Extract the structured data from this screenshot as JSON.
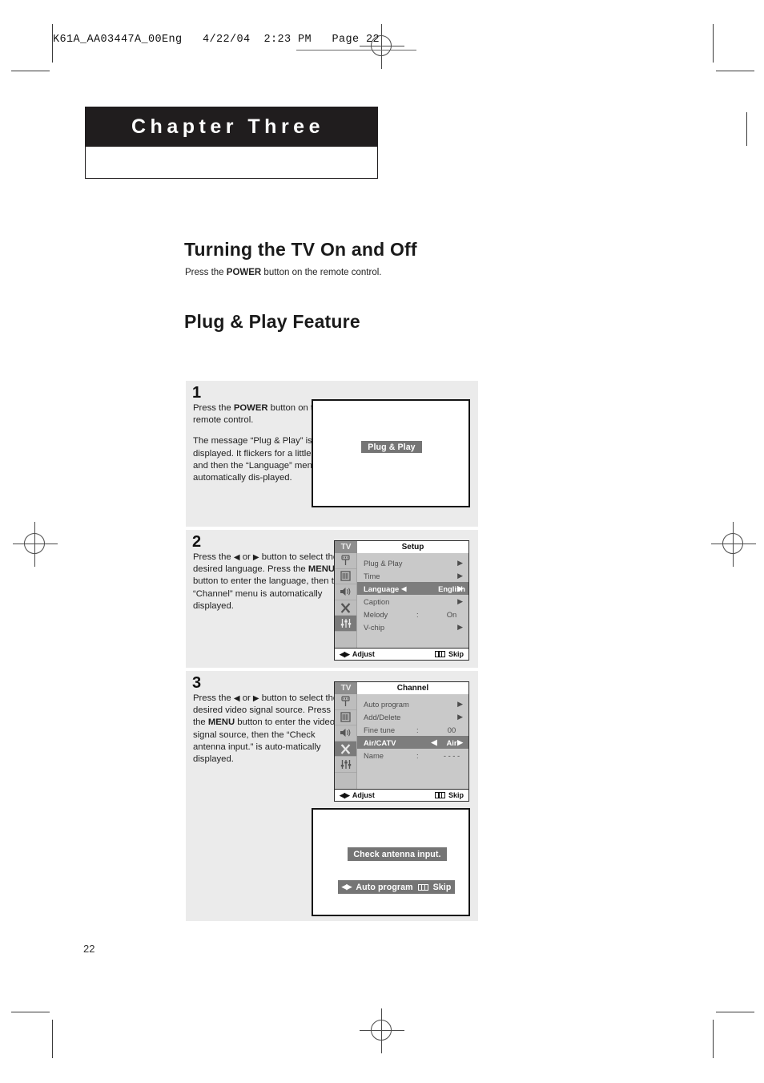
{
  "print_marks": {
    "file_header": "K61A_AA03447A_00Eng   4/22/04  2:23 PM   Page 22"
  },
  "chapter": {
    "title": "Chapter Three"
  },
  "sections": {
    "power": {
      "heading": "Turning the TV On and Off",
      "intro_before": "Press the ",
      "intro_bold": "POWER",
      "intro_after": " button on the remote control."
    },
    "plugplay": {
      "heading": "Plug & Play Feature"
    }
  },
  "steps": [
    {
      "number": "1",
      "line1_a": "Press the ",
      "line1_b": "POWER",
      "line1_c": " button on the remote control.",
      "para2": "The message “Plug & Play” is displayed. It flickers for a little while and then the “Language” menu is automatically dis-played."
    },
    {
      "number": "2",
      "t1": "Press the ",
      "arrow_left": "◀",
      "t2": " or ",
      "arrow_right": "▶",
      "t3": " button to select the desired language.",
      "t4": "Press the ",
      "bold_menu": "MENU",
      "t5": " button to enter the language, then the “Channel” menu is automatically displayed."
    },
    {
      "number": "3",
      "t1": "Press the ",
      "arrow_left": "◀",
      "t2": " or ",
      "arrow_right": "▶",
      "t3": " button to select the desired video signal source.",
      "t4": "Press the ",
      "bold_menu": "MENU",
      "t5": " button to enter the video signal source, then the “Check antenna input.” is auto-matically displayed."
    }
  ],
  "tv_screen_1": {
    "banner": "Plug & Play"
  },
  "tv_screen_3": {
    "banner": "Check antenna input.",
    "bottom_bar_label": "Auto program",
    "bottom_bar_skip": "Skip"
  },
  "osd_setup": {
    "source": "TV",
    "title": "Setup",
    "rows": [
      {
        "label": "Plug & Play",
        "arrow": "▶",
        "highlight": false
      },
      {
        "label": "Time",
        "arrow": "▶",
        "highlight": false
      },
      {
        "label": "Language",
        "left_adjust": "◀",
        "value": "English",
        "right_adjust": "▶",
        "highlight": true
      },
      {
        "label": "Caption",
        "arrow": "▶",
        "highlight": false
      },
      {
        "label": "Melody",
        "colon": ":",
        "value": "On",
        "highlight": false
      },
      {
        "label": "V-chip",
        "arrow": "▶",
        "highlight": false
      }
    ],
    "footer_adjust": "Adjust",
    "footer_skip": "Skip",
    "active_rail_index": 5
  },
  "osd_channel": {
    "source": "TV",
    "title": "Channel",
    "rows": [
      {
        "label": "Auto program",
        "arrow": "▶",
        "highlight": false
      },
      {
        "label": "Add/Delete",
        "arrow": "▶",
        "highlight": false
      },
      {
        "label": "Fine tune",
        "colon": ":",
        "value": "00",
        "highlight": false
      },
      {
        "label": "Air/CATV",
        "left_adjust": "◀",
        "value": "Air",
        "right_adjust": "▶",
        "highlight": true
      },
      {
        "label": "Name",
        "colon": ":",
        "value": "- - - -",
        "highlight": false
      }
    ],
    "footer_adjust": "Adjust",
    "footer_skip": "Skip",
    "active_rail_index": 4
  },
  "colors": {
    "panel_bg": "#ebebeb",
    "osd_bg": "#c9c9c9",
    "osd_highlight": "#7d7d7d",
    "banner_gray": "#757575",
    "chapter_black": "#201d1e"
  },
  "page_number": "22"
}
